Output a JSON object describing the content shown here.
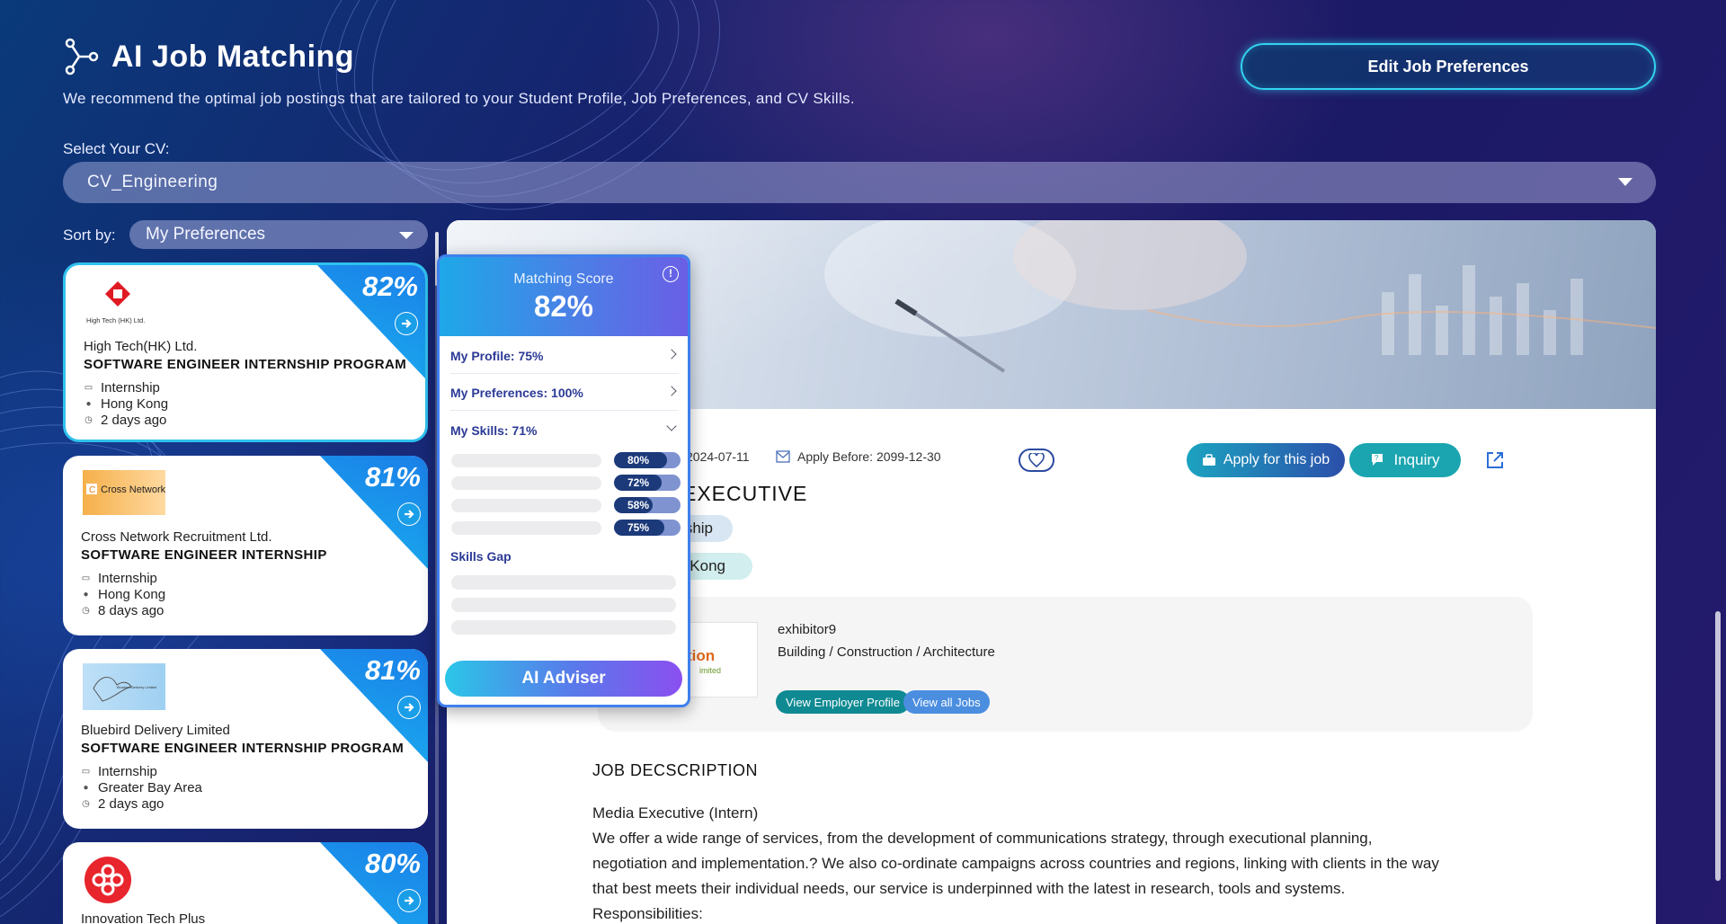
{
  "header": {
    "title": "AI Job Matching",
    "subtitle": "We recommend the optimal job postings that are tailored to your Student Profile, Job Preferences, and CV Skills.",
    "edit_button": "Edit Job Preferences"
  },
  "cv": {
    "label": "Select Your CV:",
    "selected": "CV_Engineering"
  },
  "sort": {
    "label": "Sort by:",
    "selected": "My Preferences"
  },
  "jobs": [
    {
      "score": "82%",
      "logo_text": "High Tech (HK) Ltd.",
      "company": "High Tech(HK) Ltd.",
      "title": "SOFTWARE ENGINEER INTERNSHIP PROGRAM",
      "type": "Internship",
      "location": "Hong Kong",
      "posted": "2 days ago"
    },
    {
      "score": "81%",
      "logo_text": "Cross Network",
      "company": "Cross Network Recruitment Ltd.",
      "title": "SOFTWARE ENGINEER INTERNSHIP",
      "type": "Internship",
      "location": "Hong Kong",
      "posted": "8 days ago"
    },
    {
      "score": "81%",
      "logo_text": "Bluebird Delivery Limited",
      "company": "Bluebird Delivery Limited",
      "title": "SOFTWARE ENGINEER INTERNSHIP PROGRAM",
      "type": "Internship",
      "location": "Greater Bay Area",
      "posted": "2 days ago"
    },
    {
      "score": "80%",
      "company": "Innovation Tech Plus"
    }
  ],
  "detail": {
    "posted_date": "2024-07-11",
    "apply_before": "Apply Before: 2099-12-30",
    "apply_button": "Apply for this job",
    "inquiry_button": "Inquiry",
    "job_name": "EXECUTIVE",
    "tag_type": "ship",
    "tag_location": "Kong",
    "employer": {
      "logo_text": "tion",
      "logo_subtext": "imited",
      "name": "exhibitor9",
      "industry": "Building / Construction / Architecture",
      "profile_button": "View Employer Profile",
      "jobs_button": "View all Jobs"
    },
    "jd_heading": "JOB DECSCRIPTION",
    "jd_lines": [
      "Media Executive (Intern)",
      "We offer a wide range of services, from the development of communications strategy, through executional planning,",
      "negotiation and implementation.? We also co-ordinate campaigns across countries and regions, linking with clients in the way",
      "that best meets their individual needs, our service is underpinned with the latest in research, tools and systems.",
      "Responsibilities:"
    ]
  },
  "matching": {
    "label": "Matching Score",
    "score": "82%",
    "profile": "My Profile: 75%",
    "preferences": "My Preferences: 100%",
    "skills": "My Skills: 71%",
    "skill_scores": [
      {
        "label": "80%",
        "value": 0.8
      },
      {
        "label": "72%",
        "value": 0.72
      },
      {
        "label": "58%",
        "value": 0.58
      },
      {
        "label": "75%",
        "value": 0.75
      }
    ],
    "skills_gap": "Skills Gap",
    "adviser_button": "AI Adviser"
  },
  "colors": {
    "accent": "#2fc1ee",
    "card_corner": "#1590e6",
    "popup_border": "#3f7fee",
    "primary_text": "#2b3a96"
  }
}
